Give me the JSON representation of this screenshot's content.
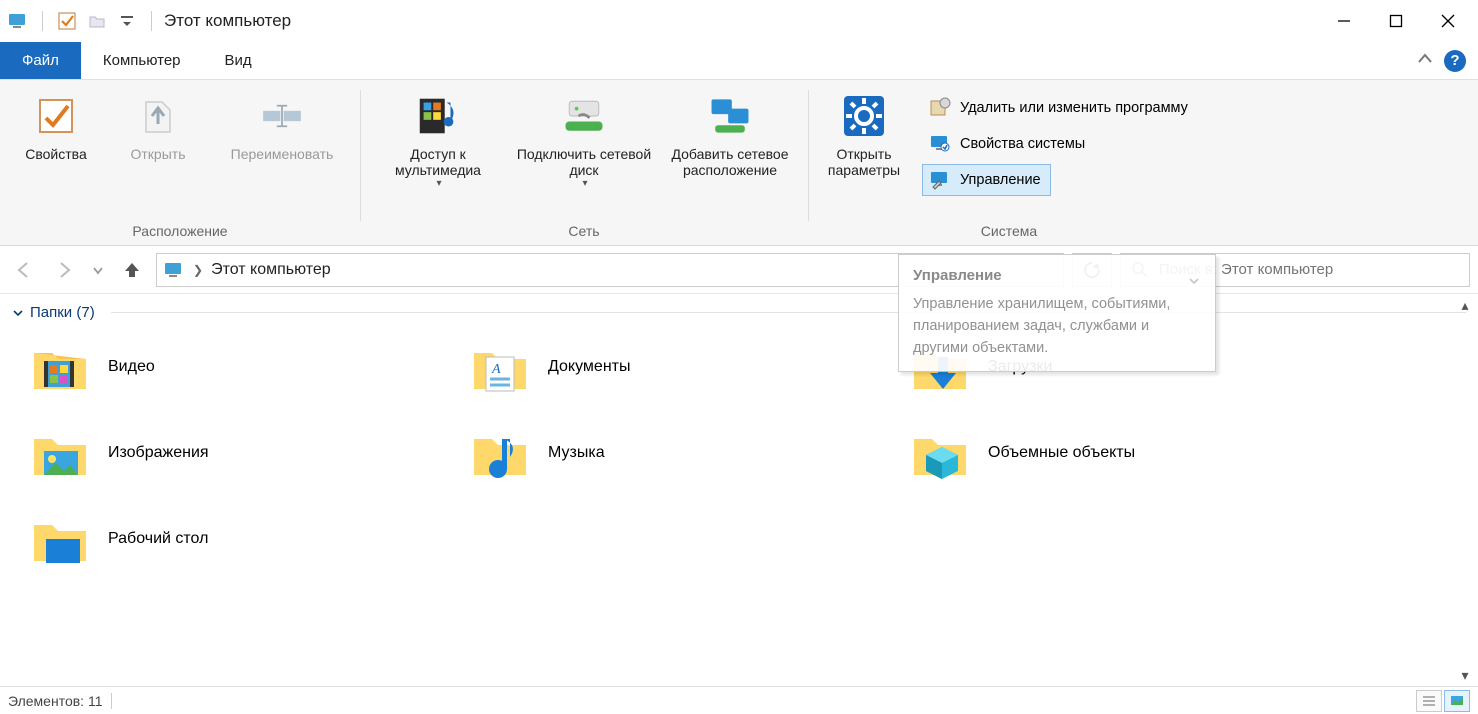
{
  "window": {
    "title": "Этот компьютер"
  },
  "tabs": {
    "file": "Файл",
    "computer": "Компьютер",
    "view": "Вид"
  },
  "ribbon": {
    "location": {
      "properties": "Свойства",
      "open": "Открыть",
      "rename": "Переименовать",
      "group_label": "Расположение"
    },
    "network": {
      "media": "Доступ к мультимедиа",
      "mapdrive": "Подключить сетевой диск",
      "addloc": "Добавить сетевое расположение",
      "group_label": "Сеть"
    },
    "system": {
      "open_settings": "Открыть параметры",
      "uninstall": "Удалить или изменить программу",
      "sys_props": "Свойства системы",
      "manage": "Управление",
      "group_label": "Система"
    }
  },
  "addressbar": {
    "location": "Этот компьютер"
  },
  "search": {
    "placeholder": "Поиск в: Этот компьютер"
  },
  "tooltip": {
    "title": "Управление",
    "body": "Управление хранилищем, событиями, планированием задач, службами и другими объектами."
  },
  "folders": {
    "header": "Папки (7)",
    "items": [
      {
        "label": "Видео"
      },
      {
        "label": "Документы"
      },
      {
        "label": "Загрузки"
      },
      {
        "label": "Изображения"
      },
      {
        "label": "Музыка"
      },
      {
        "label": "Объемные объекты"
      },
      {
        "label": "Рабочий стол"
      }
    ]
  },
  "status": {
    "items": "Элементов: 11"
  }
}
